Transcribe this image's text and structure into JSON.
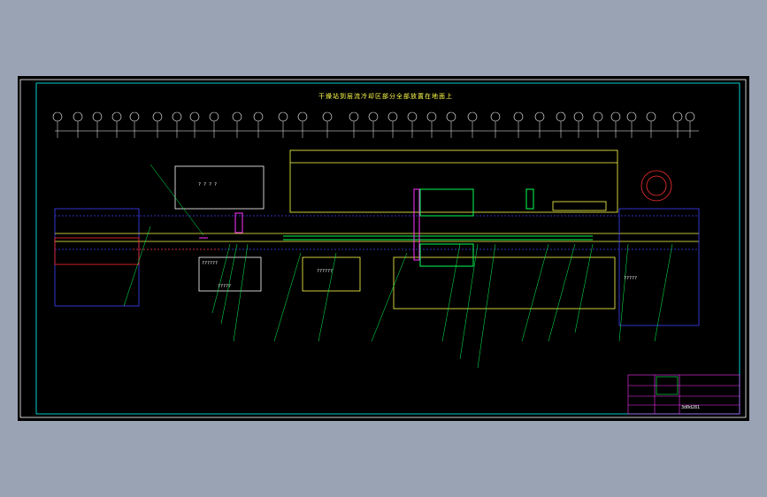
{
  "drawing": {
    "title": "干燥站到层流冷却区部分全部放置在地面上",
    "vertical_note": "",
    "question_labels": [
      "? ? ? ?",
      "??????",
      "??????",
      "?????",
      "?????"
    ],
    "title_block_code": "3d0d281",
    "colors": {
      "page_bg": "#9aa3b4",
      "sheet_bg": "#000000",
      "border": "#00ffff",
      "line_yellow": "#ffff4d",
      "line_blue": "#4040ff",
      "line_green": "#00ff55",
      "line_red": "#ff2a2a",
      "line_magenta": "#ff33ff",
      "line_white": "#ffffff"
    }
  }
}
